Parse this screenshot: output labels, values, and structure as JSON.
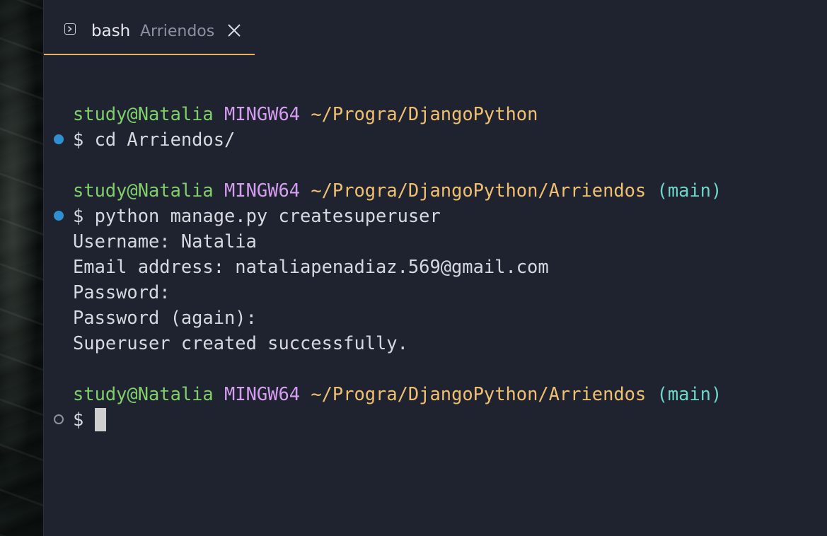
{
  "tab": {
    "title": "bash",
    "description": "Arriendos",
    "icon": "terminal-icon",
    "close_icon": "close-icon",
    "accent_color": "#e6b25e"
  },
  "colors": {
    "background": "#1f2330",
    "user": "#7fcf6a",
    "host": "#d69ef0",
    "path": "#f0c070",
    "branch": "#6ed6c8",
    "text": "#d6d9e0",
    "decoration_success": "#2f8fd0"
  },
  "terminal": {
    "block1": {
      "user": "study@Natalia",
      "host": "MINGW64",
      "path": "~/Progra/DjangoPython",
      "command": "$ cd Arriendos/"
    },
    "block2": {
      "user": "study@Natalia",
      "host": "MINGW64",
      "path": "~/Progra/DjangoPython/Arriendos",
      "branch": "(main)",
      "command": "$ python manage.py createsuperuser",
      "output": [
        "Username: Natalia",
        "Email address: nataliapenadiaz.569@gmail.com",
        "Password:",
        "Password (again):",
        "Superuser created successfully."
      ]
    },
    "block3": {
      "user": "study@Natalia",
      "host": "MINGW64",
      "path": "~/Progra/DjangoPython/Arriendos",
      "branch": "(main)",
      "prompt": "$ "
    }
  }
}
